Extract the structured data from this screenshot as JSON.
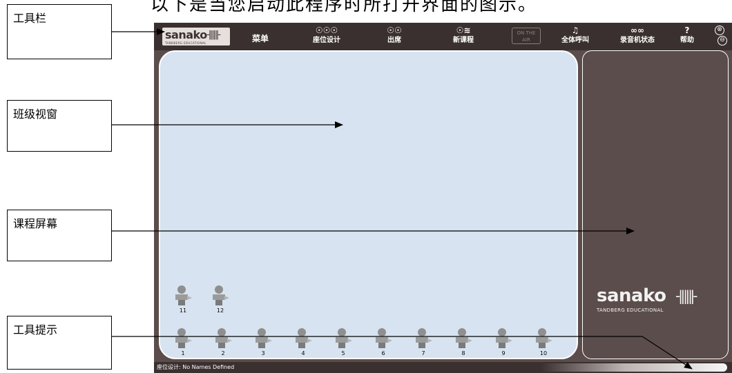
{
  "caption": "以下是当您启动此程序时所打开界面的图示。",
  "callouts": {
    "toolbar": "工具栏",
    "class_window": "班级视窗",
    "course_screen": "课程屏幕",
    "tooltip": "工具提示"
  },
  "app": {
    "logo": {
      "brand": "sanako",
      "sub": "TANDBERG EDUCATIONAL"
    },
    "toolbar": {
      "menu": "菜单",
      "seat_design": "座位设计",
      "attendance": "出席",
      "new_course": "新课程",
      "on_air": "ON THE AIR",
      "call_all": "全体呼叫",
      "recorder_status": "录音机状态",
      "help": "帮助",
      "close_symbol": "⊗",
      "minimize_symbol": "⊖"
    },
    "seats": [
      "1",
      "2",
      "3",
      "4",
      "5",
      "6",
      "7",
      "8",
      "9",
      "10",
      "11",
      "12"
    ],
    "course_logo": {
      "brand": "sanako",
      "sub": "TANDBERG EDUCATIONAL"
    },
    "status": {
      "label": "座位设计:",
      "value": "No Names Defined"
    }
  }
}
